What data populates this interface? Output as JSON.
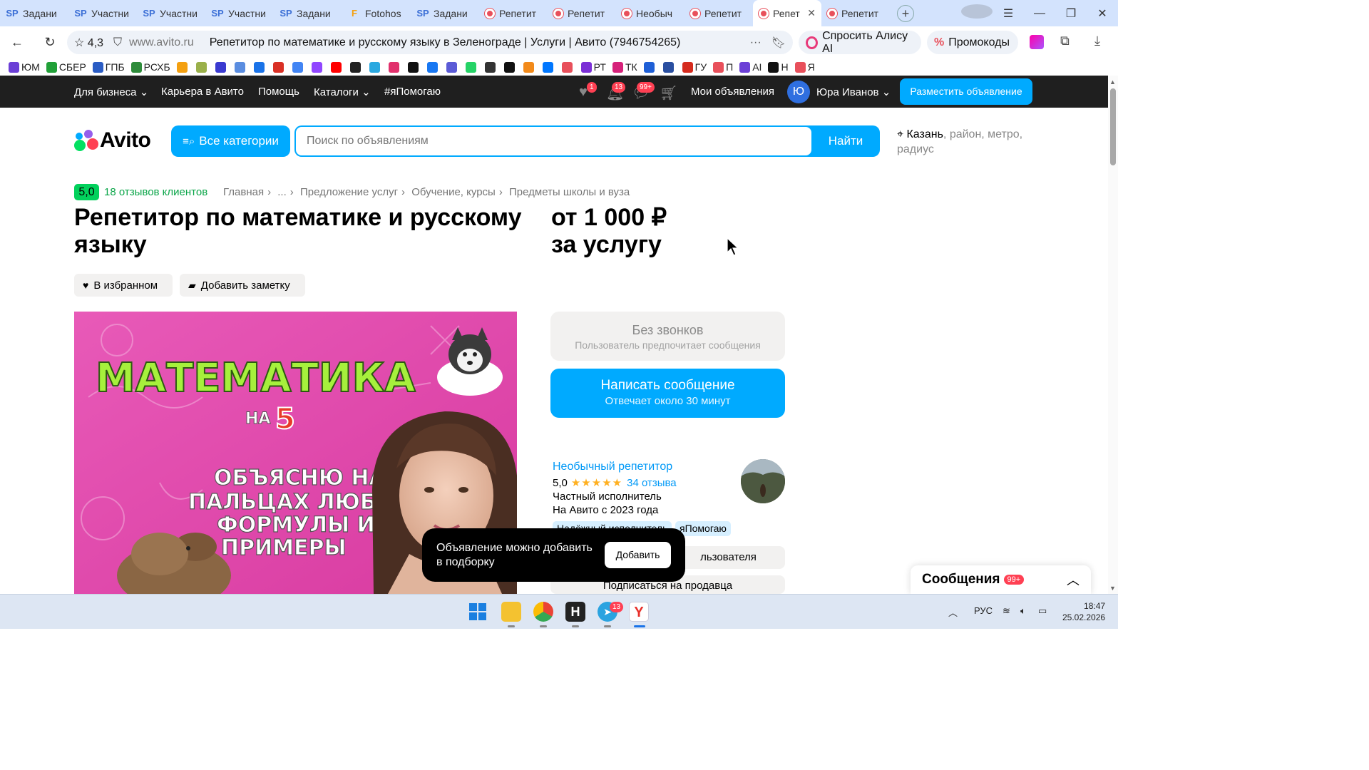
{
  "browser": {
    "tabs": [
      {
        "icon": "sp-icon",
        "glyph": "SP",
        "label": "Задани"
      },
      {
        "icon": "sp-icon",
        "glyph": "SP",
        "label": "Участни"
      },
      {
        "icon": "sp-icon",
        "glyph": "SP",
        "label": "Участни"
      },
      {
        "icon": "sp-icon",
        "glyph": "SP",
        "label": "Участни"
      },
      {
        "icon": "sp-icon",
        "glyph": "SP",
        "label": "Задани"
      },
      {
        "icon": "fotohost-icon",
        "glyph": "F",
        "label": "Fotohos"
      },
      {
        "icon": "sp-icon",
        "glyph": "SP",
        "label": "Задани"
      },
      {
        "icon": "avito-tab-icon",
        "glyph": "",
        "label": "Репетит"
      },
      {
        "icon": "avito-tab-icon",
        "glyph": "",
        "label": "Репетит"
      },
      {
        "icon": "avito-tab-icon",
        "glyph": "",
        "label": "Необыч"
      },
      {
        "icon": "avito-tab-icon",
        "glyph": "",
        "label": "Репетит"
      },
      {
        "icon": "avito-tab-icon",
        "glyph": "",
        "label": "Репет",
        "active": true
      },
      {
        "icon": "avito-tab-icon",
        "glyph": "",
        "label": "Репетит"
      }
    ],
    "site_rating": "4,3",
    "domain": "www.avito.ru",
    "page_title": "Репетитор по математике и русскому языку в Зеленограде | Услуги | Авито (7946754265)",
    "alice_label": "Спросить Алису AI",
    "promo_label": "Промокоды",
    "bookmarks": [
      {
        "label": "ЮМ",
        "color": "#6b3fd6"
      },
      {
        "label": "СБЕР",
        "color": "#21a038"
      },
      {
        "label": "ГПБ",
        "color": "#2a5cc4"
      },
      {
        "label": "РСХБ",
        "color": "#2e8b3a"
      },
      {
        "label": "",
        "color": "#f4a010"
      },
      {
        "label": "",
        "color": "#9ab04a"
      },
      {
        "label": "",
        "color": "#3a3ad0"
      },
      {
        "label": "",
        "color": "#5a8de0"
      },
      {
        "label": "",
        "color": "#1a73e8"
      },
      {
        "label": "",
        "color": "#d93025"
      },
      {
        "label": "",
        "color": "#4285f4"
      },
      {
        "label": "",
        "color": "#9146ff"
      },
      {
        "label": "",
        "color": "#ff0000"
      },
      {
        "label": "",
        "color": "#222222"
      },
      {
        "label": "",
        "color": "#2aa8e0"
      },
      {
        "label": "",
        "color": "#e1306c"
      },
      {
        "label": "",
        "color": "#111111"
      },
      {
        "label": "",
        "color": "#1877f2"
      },
      {
        "label": "",
        "color": "#5b5bd6"
      },
      {
        "label": "",
        "color": "#25d366"
      },
      {
        "label": "",
        "color": "#333333"
      },
      {
        "label": "",
        "color": "#111111"
      },
      {
        "label": "",
        "color": "#f28a1a"
      },
      {
        "label": "",
        "color": "#0077ff"
      },
      {
        "label": "",
        "color": "#e8505b"
      },
      {
        "label": "РТ",
        "color": "#7b2fd6"
      },
      {
        "label": "ТК",
        "color": "#d6227a"
      },
      {
        "label": "",
        "color": "#1f5fd6"
      },
      {
        "label": "",
        "color": "#2a4fa0"
      },
      {
        "label": "ГУ",
        "color": "#d52b1e"
      },
      {
        "label": "П",
        "color": "#e8505b"
      },
      {
        "label": "AI",
        "color": "#6b3fd6"
      },
      {
        "label": "Н",
        "color": "#111111"
      },
      {
        "label": "Я",
        "color": "#e8505b"
      }
    ]
  },
  "topbar": {
    "nav": [
      "Для бизнеса",
      "Карьера в Авито",
      "Помощь",
      "Каталоги",
      "#яПомогаю"
    ],
    "favorites_badge": "1",
    "notifications_badge": "13",
    "messages_badge": "99+",
    "my_ads": "Мои объявления",
    "avatar_letter": "Ю",
    "user_name": "Юра Иванов",
    "post_ad": "Разместить объявление"
  },
  "search": {
    "logo": "Avito",
    "categories_label": "Все категории",
    "placeholder": "Поиск по объявлениям",
    "find_label": "Найти",
    "location_city": "Казань",
    "location_rest": ", район, метро, радиус"
  },
  "breadcrumbs": {
    "rating": "5,0",
    "reviews": "18 отзывов клиентов",
    "items": [
      "Главная",
      "...",
      "Предложение услуг",
      "Обучение, курсы",
      "Предметы школы и вуза"
    ]
  },
  "listing": {
    "title": "Репетитор по математике и русскому языку",
    "price_line1": "от 1 000 ₽",
    "price_line2": "за услугу",
    "favorite_label": "В избранном",
    "note_label": "Добавить заметку",
    "image_text": {
      "line1": "МАТЕМАТИКА",
      "line2a": "НА",
      "line2b": "5",
      "line3": "ОБЪЯСНЮ НА",
      "line4": "ПАЛЬЦАХ ЛЮБЫЕ",
      "line5": "ФОРМУЛЫ И",
      "line6": "ПРИМЕРЫ"
    }
  },
  "contact": {
    "no_calls_title": "Без звонков",
    "no_calls_sub": "Пользователь предпочитает сообщения",
    "write_title": "Написать сообщение",
    "write_sub": "Отвечает около 30 минут"
  },
  "seller": {
    "name": "Необычный репетитор",
    "rating": "5,0",
    "stars": "★★★★★",
    "reviews": "34 отзыва",
    "type": "Частный исполнитель",
    "since": "На Авито с 2023 года",
    "tags": [
      "Надёжный исполнитель",
      "яПомогаю"
    ],
    "other_ads_visible": "льзователя",
    "subscribe": "Подписаться на продавца"
  },
  "toast": {
    "text": "Объявление можно добавить в подборку",
    "button": "Добавить"
  },
  "messages_widget": {
    "title": "Сообщения",
    "badge": "99+"
  },
  "taskbar": {
    "telegram_badge": "13",
    "lang": "РУС",
    "time": "18:47",
    "date": "25.02.2026"
  },
  "colors": {
    "avito_blue": "#00aaff",
    "avito_green": "#02d15c",
    "topbar_bg": "#1f1f1f",
    "photo_pink": "#e040a8",
    "headline_green": "#a6f03c"
  }
}
